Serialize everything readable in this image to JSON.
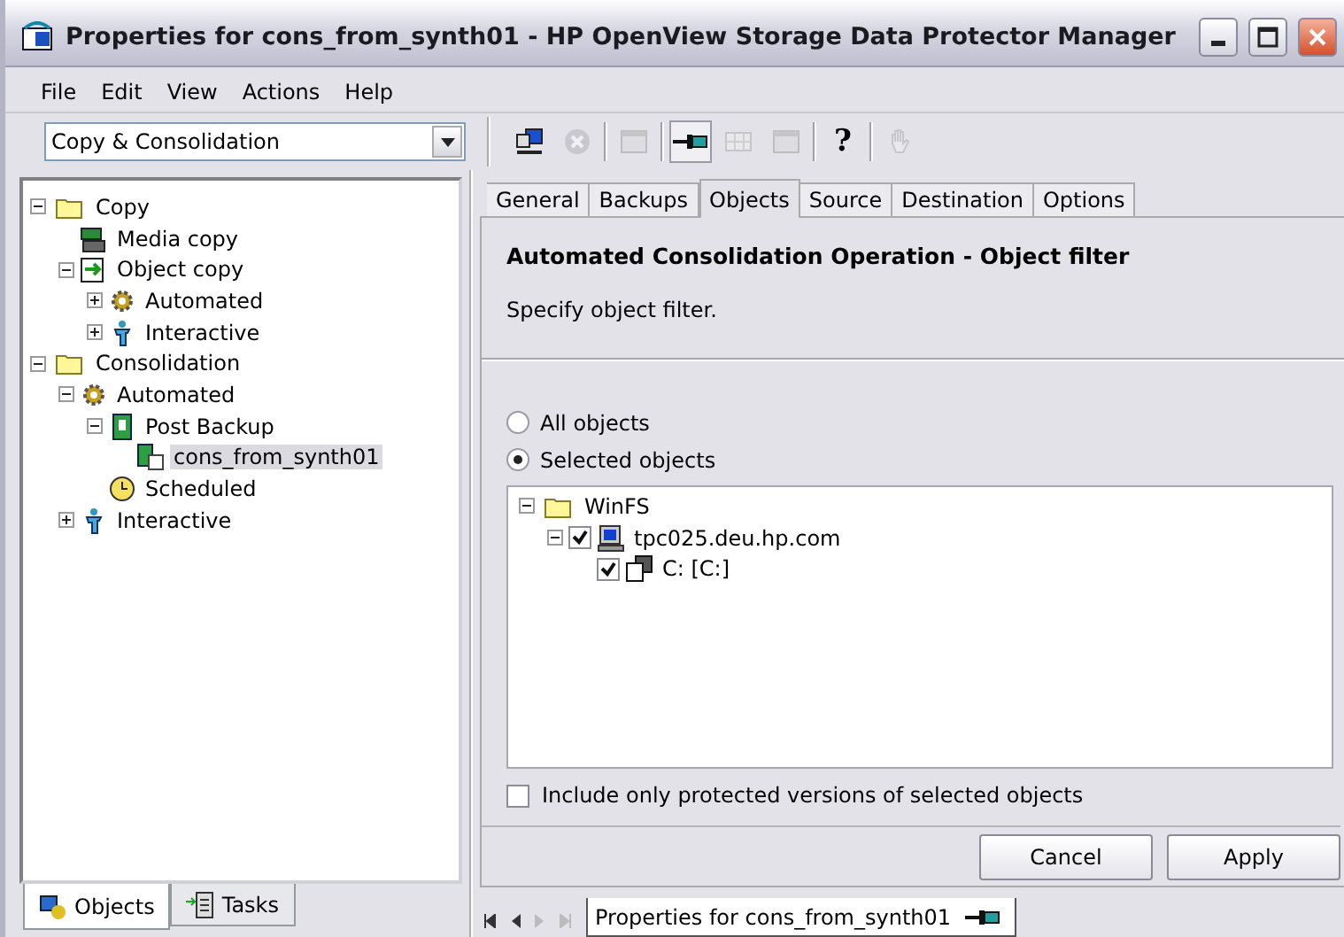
{
  "window": {
    "title": "Properties for cons_from_synth01 - HP OpenView Storage Data Protector Manager"
  },
  "menu": [
    "File",
    "Edit",
    "View",
    "Actions",
    "Help"
  ],
  "context_combo": {
    "value": "Copy & Consolidation"
  },
  "toolbar": [
    {
      "kind": "network",
      "disabled": false,
      "pressed": false
    },
    {
      "kind": "cancel",
      "disabled": true,
      "pressed": false
    },
    {
      "kind": "sep"
    },
    {
      "kind": "window",
      "disabled": true,
      "pressed": false
    },
    {
      "kind": "sep"
    },
    {
      "kind": "pin",
      "disabled": false,
      "pressed": true
    },
    {
      "kind": "grid",
      "disabled": true,
      "pressed": false
    },
    {
      "kind": "window",
      "disabled": true,
      "pressed": false
    },
    {
      "kind": "sep"
    },
    {
      "kind": "text",
      "label": "?",
      "disabled": false,
      "pressed": false
    },
    {
      "kind": "sep"
    },
    {
      "kind": "hand",
      "disabled": true,
      "pressed": false
    }
  ],
  "tree": [
    {
      "label": "Copy",
      "kind": "folder",
      "expanded": true,
      "selected": false,
      "children": [
        {
          "label": "Media copy",
          "kind": "media",
          "selected": false
        },
        {
          "label": "Object copy",
          "kind": "objcopy",
          "expanded": true,
          "selected": false,
          "children": [
            {
              "label": "Automated",
              "kind": "gear",
              "expanded": false,
              "selected": false
            },
            {
              "label": "Interactive",
              "kind": "person",
              "expanded": false,
              "selected": false
            }
          ]
        }
      ]
    },
    {
      "label": "Consolidation",
      "kind": "folder",
      "expanded": true,
      "selected": false,
      "children": [
        {
          "label": "Automated",
          "kind": "gear",
          "expanded": true,
          "selected": false,
          "children": [
            {
              "label": "Post Backup",
              "kind": "book",
              "expanded": true,
              "selected": false,
              "children": [
                {
                  "label": "cons_from_synth01",
                  "kind": "spec",
                  "selected": true
                }
              ]
            },
            {
              "label": "Scheduled",
              "kind": "clock",
              "selected": false
            }
          ]
        },
        {
          "label": "Interactive",
          "kind": "person",
          "expanded": false,
          "selected": false
        }
      ]
    }
  ],
  "left_tabs": [
    {
      "label": "Objects",
      "kind": "objects",
      "selected": true
    },
    {
      "label": "Tasks",
      "kind": "tasks",
      "selected": false
    }
  ],
  "tabs": [
    {
      "label": "General",
      "selected": false
    },
    {
      "label": "Backups",
      "selected": false
    },
    {
      "label": "Objects",
      "selected": true
    },
    {
      "label": "Source",
      "selected": false
    },
    {
      "label": "Destination",
      "selected": false
    },
    {
      "label": "Options",
      "selected": false
    }
  ],
  "heading": "Automated Consolidation Operation - Object filter",
  "description": "Specify object filter.",
  "radios": [
    {
      "label": "All objects",
      "selected": false
    },
    {
      "label": "Selected objects",
      "selected": true
    }
  ],
  "object_tree": [
    {
      "label": "WinFS",
      "kind": "folder",
      "expanded": true,
      "children": [
        {
          "label": "tpc025.deu.hp.com",
          "kind": "computer",
          "expanded": true,
          "checked": true,
          "children": [
            {
              "label": "C: [C:]",
              "kind": "drive",
              "checked": true
            }
          ]
        }
      ]
    }
  ],
  "protected_only": {
    "label": "Include only protected versions of selected objects",
    "checked": false
  },
  "buttons": [
    "Cancel",
    "Apply"
  ],
  "bottom_tab": {
    "label": "Properties for cons_from_synth01"
  }
}
